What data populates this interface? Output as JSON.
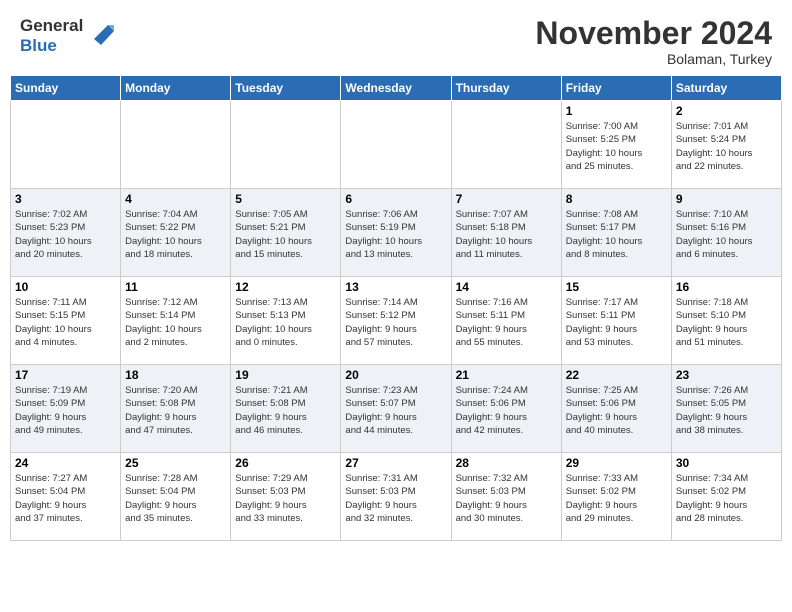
{
  "header": {
    "logo_line1": "General",
    "logo_line2": "Blue",
    "month": "November 2024",
    "location": "Bolaman, Turkey"
  },
  "weekdays": [
    "Sunday",
    "Monday",
    "Tuesday",
    "Wednesday",
    "Thursday",
    "Friday",
    "Saturday"
  ],
  "weeks": [
    [
      {
        "day": "",
        "info": ""
      },
      {
        "day": "",
        "info": ""
      },
      {
        "day": "",
        "info": ""
      },
      {
        "day": "",
        "info": ""
      },
      {
        "day": "",
        "info": ""
      },
      {
        "day": "1",
        "info": "Sunrise: 7:00 AM\nSunset: 5:25 PM\nDaylight: 10 hours\nand 25 minutes."
      },
      {
        "day": "2",
        "info": "Sunrise: 7:01 AM\nSunset: 5:24 PM\nDaylight: 10 hours\nand 22 minutes."
      }
    ],
    [
      {
        "day": "3",
        "info": "Sunrise: 7:02 AM\nSunset: 5:23 PM\nDaylight: 10 hours\nand 20 minutes."
      },
      {
        "day": "4",
        "info": "Sunrise: 7:04 AM\nSunset: 5:22 PM\nDaylight: 10 hours\nand 18 minutes."
      },
      {
        "day": "5",
        "info": "Sunrise: 7:05 AM\nSunset: 5:21 PM\nDaylight: 10 hours\nand 15 minutes."
      },
      {
        "day": "6",
        "info": "Sunrise: 7:06 AM\nSunset: 5:19 PM\nDaylight: 10 hours\nand 13 minutes."
      },
      {
        "day": "7",
        "info": "Sunrise: 7:07 AM\nSunset: 5:18 PM\nDaylight: 10 hours\nand 11 minutes."
      },
      {
        "day": "8",
        "info": "Sunrise: 7:08 AM\nSunset: 5:17 PM\nDaylight: 10 hours\nand 8 minutes."
      },
      {
        "day": "9",
        "info": "Sunrise: 7:10 AM\nSunset: 5:16 PM\nDaylight: 10 hours\nand 6 minutes."
      }
    ],
    [
      {
        "day": "10",
        "info": "Sunrise: 7:11 AM\nSunset: 5:15 PM\nDaylight: 10 hours\nand 4 minutes."
      },
      {
        "day": "11",
        "info": "Sunrise: 7:12 AM\nSunset: 5:14 PM\nDaylight: 10 hours\nand 2 minutes."
      },
      {
        "day": "12",
        "info": "Sunrise: 7:13 AM\nSunset: 5:13 PM\nDaylight: 10 hours\nand 0 minutes."
      },
      {
        "day": "13",
        "info": "Sunrise: 7:14 AM\nSunset: 5:12 PM\nDaylight: 9 hours\nand 57 minutes."
      },
      {
        "day": "14",
        "info": "Sunrise: 7:16 AM\nSunset: 5:11 PM\nDaylight: 9 hours\nand 55 minutes."
      },
      {
        "day": "15",
        "info": "Sunrise: 7:17 AM\nSunset: 5:11 PM\nDaylight: 9 hours\nand 53 minutes."
      },
      {
        "day": "16",
        "info": "Sunrise: 7:18 AM\nSunset: 5:10 PM\nDaylight: 9 hours\nand 51 minutes."
      }
    ],
    [
      {
        "day": "17",
        "info": "Sunrise: 7:19 AM\nSunset: 5:09 PM\nDaylight: 9 hours\nand 49 minutes."
      },
      {
        "day": "18",
        "info": "Sunrise: 7:20 AM\nSunset: 5:08 PM\nDaylight: 9 hours\nand 47 minutes."
      },
      {
        "day": "19",
        "info": "Sunrise: 7:21 AM\nSunset: 5:08 PM\nDaylight: 9 hours\nand 46 minutes."
      },
      {
        "day": "20",
        "info": "Sunrise: 7:23 AM\nSunset: 5:07 PM\nDaylight: 9 hours\nand 44 minutes."
      },
      {
        "day": "21",
        "info": "Sunrise: 7:24 AM\nSunset: 5:06 PM\nDaylight: 9 hours\nand 42 minutes."
      },
      {
        "day": "22",
        "info": "Sunrise: 7:25 AM\nSunset: 5:06 PM\nDaylight: 9 hours\nand 40 minutes."
      },
      {
        "day": "23",
        "info": "Sunrise: 7:26 AM\nSunset: 5:05 PM\nDaylight: 9 hours\nand 38 minutes."
      }
    ],
    [
      {
        "day": "24",
        "info": "Sunrise: 7:27 AM\nSunset: 5:04 PM\nDaylight: 9 hours\nand 37 minutes."
      },
      {
        "day": "25",
        "info": "Sunrise: 7:28 AM\nSunset: 5:04 PM\nDaylight: 9 hours\nand 35 minutes."
      },
      {
        "day": "26",
        "info": "Sunrise: 7:29 AM\nSunset: 5:03 PM\nDaylight: 9 hours\nand 33 minutes."
      },
      {
        "day": "27",
        "info": "Sunrise: 7:31 AM\nSunset: 5:03 PM\nDaylight: 9 hours\nand 32 minutes."
      },
      {
        "day": "28",
        "info": "Sunrise: 7:32 AM\nSunset: 5:03 PM\nDaylight: 9 hours\nand 30 minutes."
      },
      {
        "day": "29",
        "info": "Sunrise: 7:33 AM\nSunset: 5:02 PM\nDaylight: 9 hours\nand 29 minutes."
      },
      {
        "day": "30",
        "info": "Sunrise: 7:34 AM\nSunset: 5:02 PM\nDaylight: 9 hours\nand 28 minutes."
      }
    ]
  ]
}
